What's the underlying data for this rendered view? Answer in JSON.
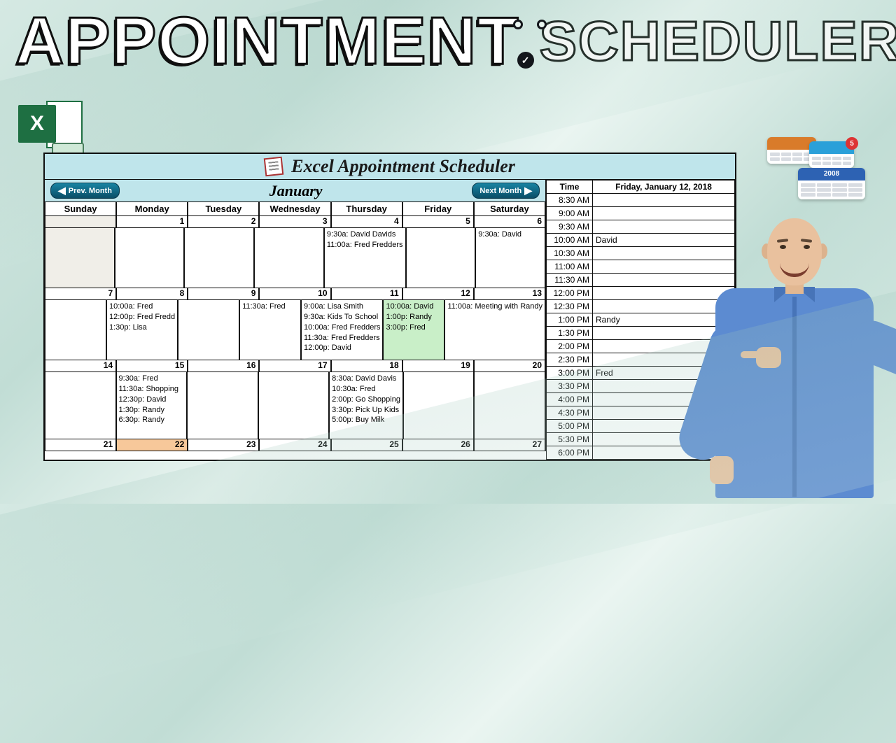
{
  "title": {
    "word1": "APPOINTMENT",
    "word2": "SCHEDULER"
  },
  "decor": {
    "badge_check": "✓",
    "mini_year": "2008",
    "mini_day": "5"
  },
  "app": {
    "heading": "Excel Appointment Scheduler",
    "month": "January",
    "prev": "Prev. Month",
    "next": "Next Month",
    "dow": [
      "Sunday",
      "Monday",
      "Tuesday",
      "Wednesday",
      "Thursday",
      "Friday",
      "Saturday"
    ],
    "weeks": [
      {
        "nums": [
          "",
          "1",
          "2",
          "3",
          "4",
          "5",
          "6"
        ],
        "cells": [
          {
            "shade": true,
            "lines": []
          },
          {
            "lines": []
          },
          {
            "lines": []
          },
          {
            "lines": []
          },
          {
            "lines": [
              "9:30a: David Davids",
              "11:00a: Fred Fredders"
            ]
          },
          {
            "lines": []
          },
          {
            "lines": [
              "9:30a: David"
            ]
          }
        ]
      },
      {
        "nums": [
          "7",
          "8",
          "9",
          "10",
          "11",
          "12",
          "13"
        ],
        "cells": [
          {
            "lines": []
          },
          {
            "lines": [
              "10:00a: Fred",
              "12:00p: Fred Fredd",
              "1:30p: Lisa"
            ]
          },
          {
            "lines": []
          },
          {
            "lines": [
              "11:30a: Fred"
            ]
          },
          {
            "lines": [
              "9:00a: Lisa Smith",
              "9:30a: Kids To School",
              "10:00a: Fred Fredders",
              "11:30a: Fred Fredders",
              "12:00p: David"
            ]
          },
          {
            "hi": true,
            "lines": [
              "10:00a: David",
              "1:00p: Randy",
              "3:00p: Fred"
            ]
          },
          {
            "lines": [
              "11:00a: Meeting with Randy"
            ]
          }
        ]
      },
      {
        "nums": [
          "14",
          "15",
          "16",
          "17",
          "18",
          "19",
          "20"
        ],
        "cells": [
          {
            "lines": []
          },
          {
            "lines": [
              "9:30a: Fred",
              "11:30a: Shopping",
              "12:30p: David",
              "1:30p: Randy",
              "6:30p: Randy"
            ]
          },
          {
            "lines": []
          },
          {
            "lines": []
          },
          {
            "lines": [
              "8:30a: David Davis",
              "10:30a: Fred",
              "2:00p: Go Shopping",
              "3:30p: Pick Up Kids",
              "5:00p: Buy Milk"
            ]
          },
          {
            "lines": []
          },
          {
            "lines": []
          }
        ]
      },
      {
        "nums": [
          "21",
          "22",
          "23",
          "24",
          "25",
          "26",
          "27"
        ],
        "hot_idx": 1
      }
    ]
  },
  "day": {
    "time_hdr": "Time",
    "date": "Friday, January 12, 2018",
    "rows": [
      {
        "t": "8:30 AM",
        "v": ""
      },
      {
        "t": "9:00 AM",
        "v": ""
      },
      {
        "t": "9:30 AM",
        "v": ""
      },
      {
        "t": "10:00 AM",
        "v": "David"
      },
      {
        "t": "10:30 AM",
        "v": ""
      },
      {
        "t": "11:00 AM",
        "v": ""
      },
      {
        "t": "11:30 AM",
        "v": ""
      },
      {
        "t": "12:00 PM",
        "v": ""
      },
      {
        "t": "12:30 PM",
        "v": ""
      },
      {
        "t": "1:00 PM",
        "v": "Randy"
      },
      {
        "t": "1:30 PM",
        "v": ""
      },
      {
        "t": "2:00 PM",
        "v": ""
      },
      {
        "t": "2:30 PM",
        "v": ""
      },
      {
        "t": "3:00 PM",
        "v": "Fred"
      },
      {
        "t": "3:30 PM",
        "v": ""
      },
      {
        "t": "4:00 PM",
        "v": ""
      },
      {
        "t": "4:30 PM",
        "v": ""
      },
      {
        "t": "5:00 PM",
        "v": ""
      },
      {
        "t": "5:30 PM",
        "v": ""
      },
      {
        "t": "6:00 PM",
        "v": ""
      }
    ]
  }
}
